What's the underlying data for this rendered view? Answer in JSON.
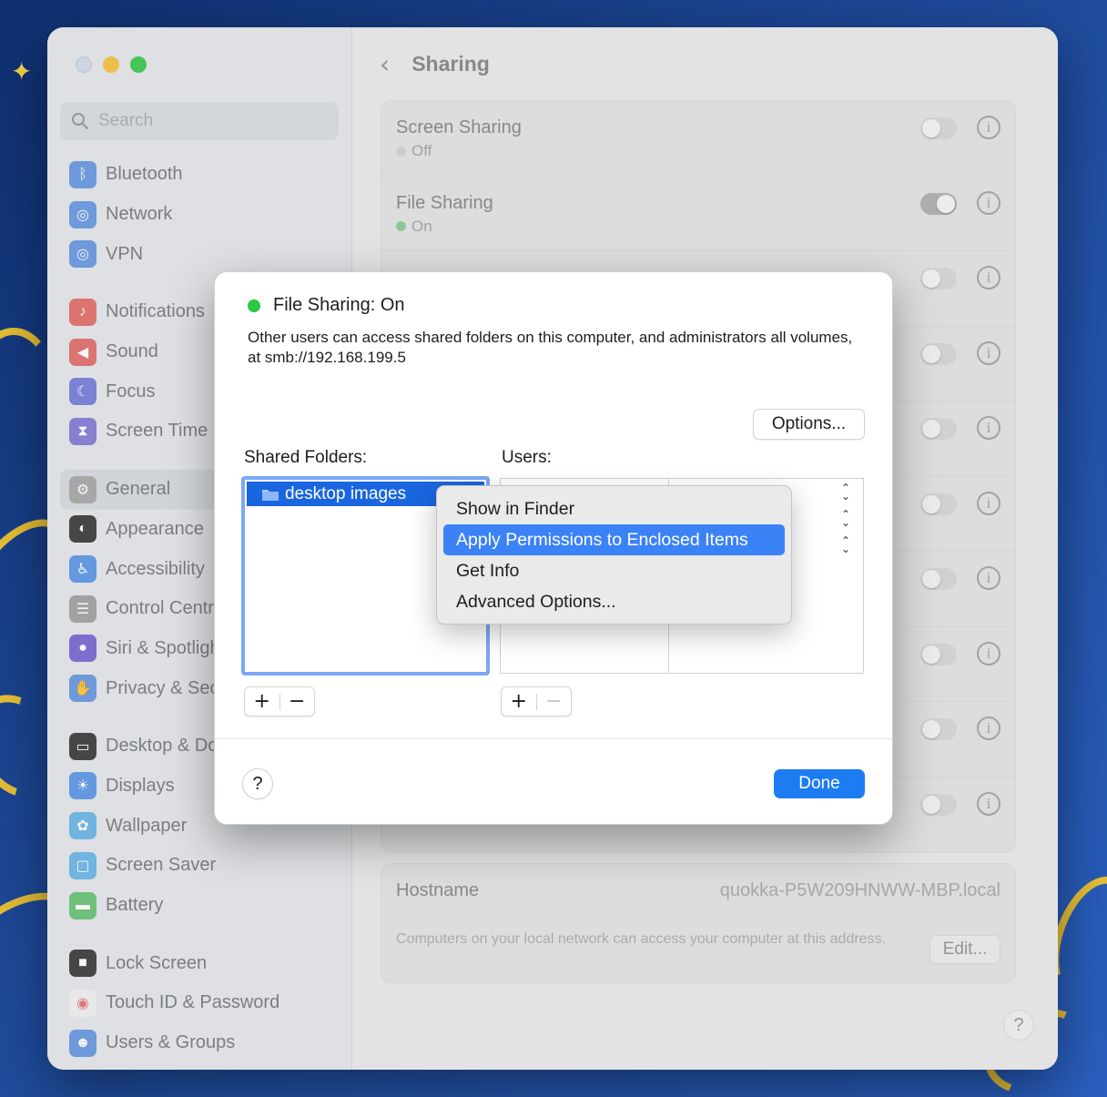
{
  "sidebar": {
    "search_placeholder": "Search",
    "items": [
      {
        "label": "Bluetooth",
        "icon": "bluetooth-icon",
        "color": "#5b8fe0"
      },
      {
        "label": "Network",
        "icon": "globe-icon",
        "color": "#5b8fe0"
      },
      {
        "label": "VPN",
        "icon": "vpn-globe-icon",
        "color": "#5b8fe0"
      },
      {
        "label": "Notifications",
        "icon": "bell-icon",
        "color": "#e0625f"
      },
      {
        "label": "Sound",
        "icon": "speaker-icon",
        "color": "#e0625f"
      },
      {
        "label": "Focus",
        "icon": "moon-icon",
        "color": "#6b73d6"
      },
      {
        "label": "Screen Time",
        "icon": "hourglass-icon",
        "color": "#7a6fd0"
      },
      {
        "label": "General",
        "icon": "gear-icon",
        "color": "#a0a0a0"
      },
      {
        "label": "Appearance",
        "icon": "appearance-icon",
        "color": "#2a2a2a"
      },
      {
        "label": "Accessibility",
        "icon": "accessibility-icon",
        "color": "#4f8ee6"
      },
      {
        "label": "Control Centre",
        "icon": "control-centre-icon",
        "color": "#9a9a9a"
      },
      {
        "label": "Siri & Spotlight",
        "icon": "siri-icon",
        "color": "#6c5bd0"
      },
      {
        "label": "Privacy & Security",
        "icon": "hand-icon",
        "color": "#5b8fe0"
      },
      {
        "label": "Desktop & Dock",
        "icon": "dock-icon",
        "color": "#2a2a2a"
      },
      {
        "label": "Displays",
        "icon": "sun-icon",
        "color": "#4f8ee6"
      },
      {
        "label": "Wallpaper",
        "icon": "flower-icon",
        "color": "#5fb0e6"
      },
      {
        "label": "Screen Saver",
        "icon": "screensaver-icon",
        "color": "#5fb0e6"
      },
      {
        "label": "Battery",
        "icon": "battery-icon",
        "color": "#5bbf6a"
      },
      {
        "label": "Lock Screen",
        "icon": "lock-icon",
        "color": "#2a2a2a"
      },
      {
        "label": "Touch ID & Password",
        "icon": "fingerprint-icon",
        "color": "#f0f0f0"
      },
      {
        "label": "Users & Groups",
        "icon": "users-icon",
        "color": "#5b8fe0"
      }
    ]
  },
  "main": {
    "title": "Sharing",
    "services": [
      {
        "title": "Screen Sharing",
        "status": "Off",
        "on": false
      },
      {
        "title": "File Sharing",
        "status": "On",
        "on": true
      }
    ],
    "hostname": {
      "label": "Hostname",
      "value": "quokka-P5W209HNWW-MBP.local",
      "description": "Computers on your local network can access your computer at this address.",
      "edit_label": "Edit..."
    },
    "help": "?"
  },
  "dialog": {
    "title": "File Sharing: On",
    "description": "Other users can access shared folders on this computer, and administrators all volumes, at smb://192.168.199.5",
    "options_label": "Options...",
    "shared_folders_label": "Shared Folders:",
    "users_label": "Users:",
    "folder": "desktop images",
    "add": "+",
    "remove": "−",
    "help": "?",
    "done_label": "Done",
    "status_color": "#28c840",
    "accent_color": "#1d7cf2"
  },
  "context_menu": {
    "items": [
      "Show in Finder",
      "Apply Permissions to Enclosed Items",
      "Get Info",
      "Advanced Options..."
    ],
    "highlighted": "Apply Permissions to Enclosed Items"
  }
}
